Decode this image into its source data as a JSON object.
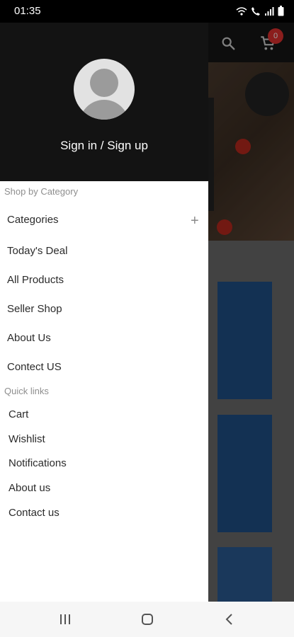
{
  "status_bar": {
    "time": "01:35",
    "icons": [
      "wifi-icon",
      "call-icon",
      "signal-icon",
      "battery-icon"
    ]
  },
  "app_behind": {
    "cart_count": "0",
    "icons": [
      "search-icon",
      "cart-icon"
    ]
  },
  "drawer": {
    "signin_label": "Sign in / Sign up",
    "shop_section": {
      "label": "Shop by Category",
      "items": [
        {
          "label": "Categories",
          "expandable": true
        },
        {
          "label": "Today's Deal"
        },
        {
          "label": "All Products"
        },
        {
          "label": "Seller Shop"
        },
        {
          "label": "About Us"
        },
        {
          "label": "Contect US"
        }
      ]
    },
    "quick_section": {
      "label": "Quick links",
      "items": [
        {
          "label": "Cart"
        },
        {
          "label": "Wishlist"
        },
        {
          "label": "Notifications"
        },
        {
          "label": "About us"
        },
        {
          "label": "Contact us"
        }
      ]
    }
  },
  "nav_bar": {
    "buttons": [
      "recent-apps-icon",
      "home-icon",
      "back-icon"
    ]
  },
  "colors": {
    "drawer_header": "#131313",
    "badge": "#e0312f",
    "card_blue": "#1f4f86"
  }
}
